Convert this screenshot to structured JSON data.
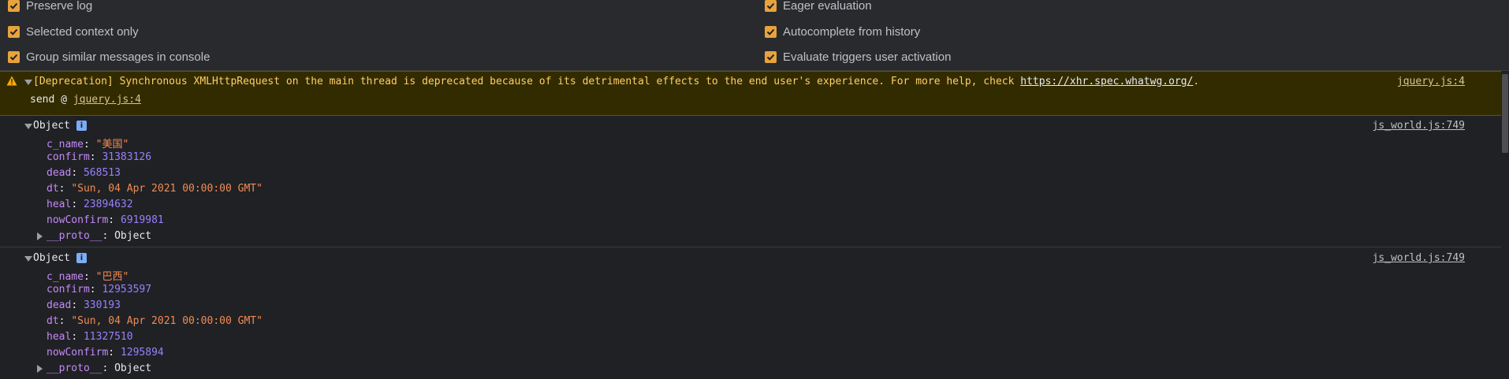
{
  "settings": {
    "left": [
      {
        "label": "Preserve log"
      },
      {
        "label": "Selected context only"
      },
      {
        "label": "Group similar messages in console"
      }
    ],
    "right": [
      {
        "label": "Eager evaluation"
      },
      {
        "label": "Autocomplete from history"
      },
      {
        "label": "Evaluate triggers user activation"
      }
    ]
  },
  "warning": {
    "message": "[Deprecation] Synchronous XMLHttpRequest on the main thread is deprecated because of its detrimental effects to the end user's experience. For more help, check ",
    "url": "https://xhr.spec.whatwg.org/",
    "after": ".",
    "source": "jquery.js:4",
    "send_prefix": "send @ ",
    "send_link": "jquery.js:4"
  },
  "objects": [
    {
      "title": "Object",
      "badge": "i",
      "source": "js_world.js:749",
      "props": {
        "c_name": {
          "key": "c_name",
          "value": "\"美国\""
        },
        "confirm": {
          "key": "confirm",
          "value": "31383126"
        },
        "dead": {
          "key": "dead",
          "value": "568513"
        },
        "dt": {
          "key": "dt",
          "value": "\"Sun, 04 Apr 2021 00:00:00 GMT\""
        },
        "heal": {
          "key": "heal",
          "value": "23894632"
        },
        "nowConfirm": {
          "key": "nowConfirm",
          "value": "6919981"
        },
        "proto": {
          "key": "__proto__",
          "value": "Object"
        }
      }
    },
    {
      "title": "Object",
      "badge": "i",
      "source": "js_world.js:749",
      "props": {
        "c_name": {
          "key": "c_name",
          "value": "\"巴西\""
        },
        "confirm": {
          "key": "confirm",
          "value": "12953597"
        },
        "dead": {
          "key": "dead",
          "value": "330193"
        },
        "dt": {
          "key": "dt",
          "value": "\"Sun, 04 Apr 2021 00:00:00 GMT\""
        },
        "heal": {
          "key": "heal",
          "value": "11327510"
        },
        "nowConfirm": {
          "key": "nowConfirm",
          "value": "1295894"
        },
        "proto": {
          "key": "__proto__",
          "value": "Object"
        }
      }
    }
  ],
  "colors": {
    "checkbox": "#e8a33d",
    "warning_bg": "#332b00",
    "warning_text": "#fdd063",
    "key": "#c58af9",
    "string": "#f28b54",
    "number": "#9980ff"
  }
}
